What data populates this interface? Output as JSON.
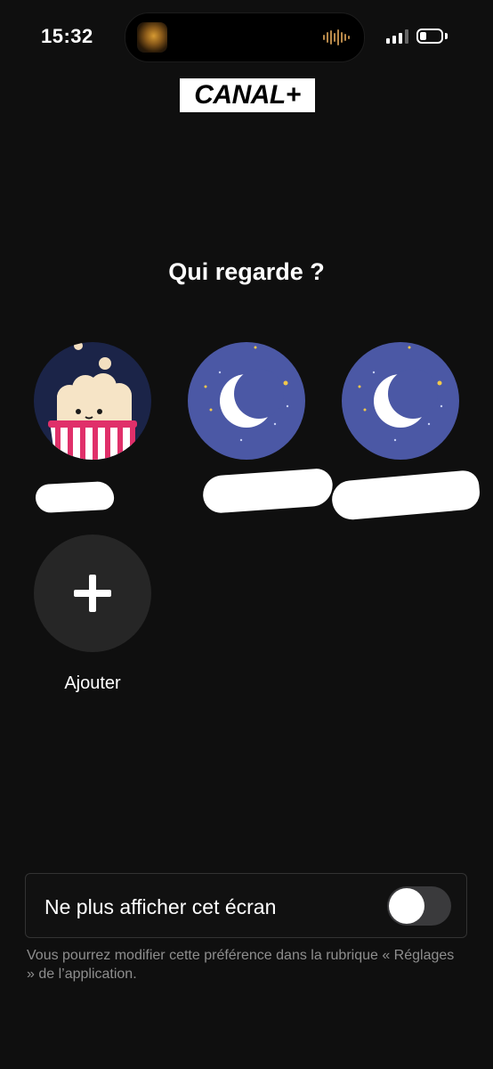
{
  "status_bar": {
    "time": "15:32",
    "battery_level": 0.3
  },
  "brand": {
    "logo_text": "CANAL+"
  },
  "heading": "Qui regarde ?",
  "profiles": [
    {
      "avatar": "popcorn",
      "name_redacted": true
    },
    {
      "avatar": "moon",
      "name_redacted": true
    },
    {
      "avatar": "moon",
      "name_redacted": true
    }
  ],
  "add_profile": {
    "label": "Ajouter",
    "icon": "plus-icon"
  },
  "preference": {
    "label": "Ne plus afficher cet écran",
    "toggle_on": false,
    "note": "Vous pourrez modifier cette préférence dans la rubrique « Réglages » de l’application."
  },
  "colors": {
    "background": "#0f0f0f",
    "moon_avatar_bg": "#4b58a5",
    "popcorn_avatar_bg": "#1b2448",
    "stripe_red": "#e0306a",
    "star_yellow": "#f2c84b"
  }
}
